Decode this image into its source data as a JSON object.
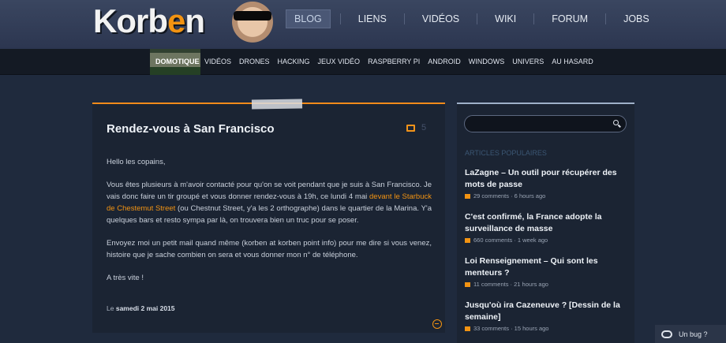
{
  "header": {
    "logo": {
      "pre": "Korb",
      "o": "e",
      "post": "n"
    },
    "nav": [
      {
        "label": "BLOG",
        "active": true
      },
      {
        "label": "LIENS"
      },
      {
        "label": "VIDÉOS"
      },
      {
        "label": "WIKI"
      },
      {
        "label": "FORUM"
      },
      {
        "label": "JOBS"
      }
    ]
  },
  "categories": [
    "DOMOTIQUE",
    "VIDÉOS",
    "DRONES",
    "HACKING",
    "JEUX VIDÉO",
    "RASPBERRY PI",
    "ANDROID",
    "WINDOWS",
    "UNIVERS",
    "AU HASARD"
  ],
  "article": {
    "title": "Rendez-vous à San Francisco",
    "comments": "5",
    "p1": "Hello les copains,",
    "p2_before": "Vous êtes plusieurs à m'avoir contacté pour qu'on se voit pendant que je suis à San Francisco. Je vais donc faire un tir groupé et vous donner rendez-vous à 19h, ce lundi 4 mai ",
    "p2_link": "devant le Starbuck de Chestemut Street",
    "p2_after": " (ou Chestnut Street, y'a les 2 orthographe) dans le quartier de la Marina. Y'a quelques bars et resto sympa par là, on trouvera bien un truc pour se poser.",
    "p3": "Envoyez moi un petit mail quand même (korben at korben point info) pour me dire si vous venez, histoire que je sache combien on sera et vous donner mon n° de téléphone.",
    "p4": "A très vite !",
    "date_prefix": "Le",
    "date": "samedi 2 mai 2015"
  },
  "sidebar": {
    "section_title": "ARTICLES POPULAIRES",
    "posts": [
      {
        "title": "LaZagne – Un outil pour récupérer des mots de passe",
        "meta": "29 comments · 6 hours ago"
      },
      {
        "title": "C'est confirmé, la France adopte la surveillance de masse",
        "meta": "660 comments · 1 week ago"
      },
      {
        "title": "Loi Renseignement – Qui sont les menteurs ?",
        "meta": "11 comments · 21 hours ago"
      },
      {
        "title": "Jusqu'où ira Cazeneuve ? [Dessin de la semaine]",
        "meta": "33 comments · 15 hours ago"
      }
    ]
  },
  "bug_button": "Un bug ?"
}
